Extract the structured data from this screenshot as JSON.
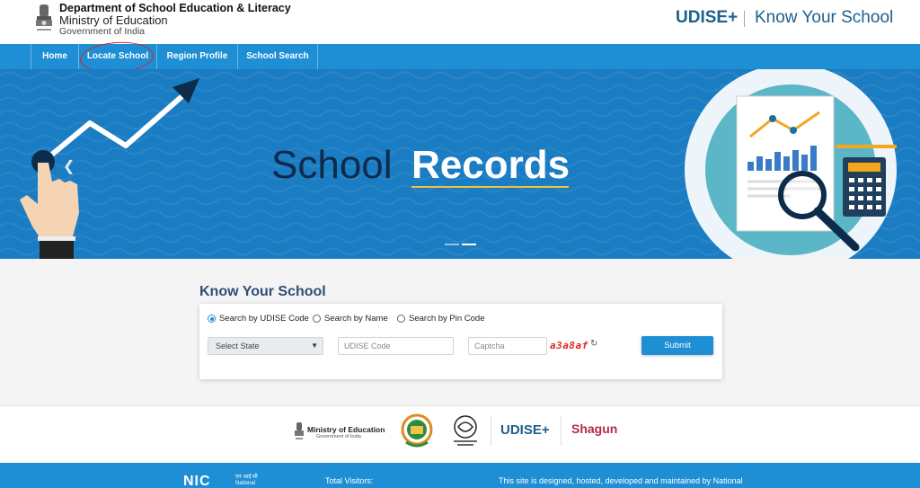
{
  "header": {
    "department": "Department of School Education & Literacy",
    "ministry": "Ministry of Education",
    "government": "Government of India",
    "brand_udise": "UDISE+",
    "brand_kys": "Know Your School"
  },
  "nav": {
    "items": [
      {
        "label": "Home"
      },
      {
        "label": "Locate School"
      },
      {
        "label": "Region Profile"
      },
      {
        "label": "School Search"
      }
    ],
    "annotated_item": "Locate School"
  },
  "banner": {
    "title_plain": "School",
    "title_bold": "Records",
    "prev_icon": "chevron-left-icon"
  },
  "search": {
    "title": "Know Your School",
    "options": [
      {
        "label": "Search by UDISE Code",
        "selected": true
      },
      {
        "label": "Search by Name",
        "selected": false
      },
      {
        "label": "Search by Pin Code",
        "selected": false
      }
    ],
    "state_select": "Select State",
    "udise_placeholder": "UDISE Code",
    "captcha_placeholder": "Captcha",
    "captcha_value": "a3a8af",
    "refresh_icon": "refresh-icon",
    "submit_label": "Submit"
  },
  "partners": {
    "moe_label": "Ministry of Education",
    "moe_sub": "Government of India",
    "udise": "UDISE+",
    "shagun": "Shagun"
  },
  "footer": {
    "nic_logo": "NIC",
    "nic_hindi_1": "एन आई सी",
    "nic_hindi_2": "National",
    "visitors_label": "Total Visitors:",
    "designed_text": "This site is designed, hosted, developed and maintained by National"
  },
  "colors": {
    "nav_blue": "#1e8fd4",
    "banner_blue": "#1a7cc2",
    "brand_blue": "#1d5f8e",
    "captcha_red": "#e02424",
    "shagun": "#b22a4a"
  }
}
